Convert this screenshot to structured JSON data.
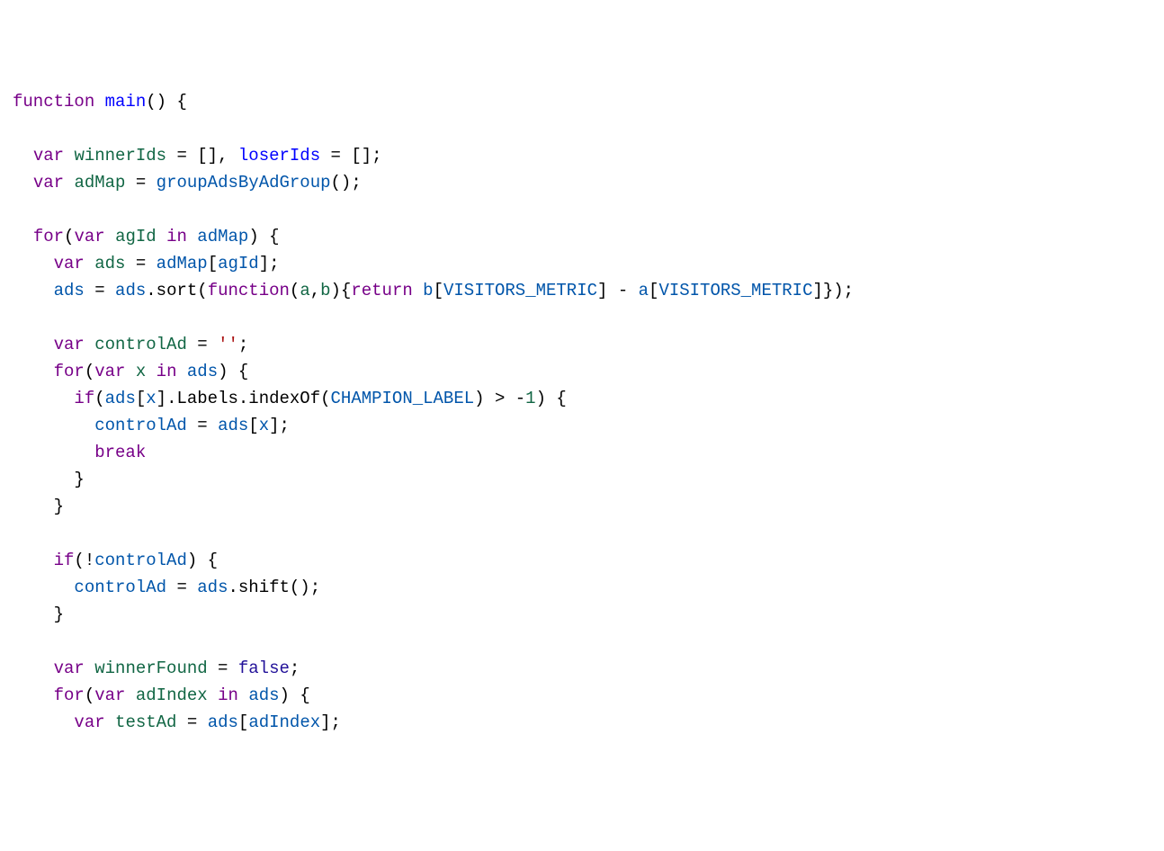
{
  "code": {
    "tokens": [
      [
        {
          "t": "function",
          "c": "kw"
        },
        {
          "t": " "
        },
        {
          "t": "main",
          "c": "fn"
        },
        {
          "t": "() {"
        }
      ],
      [
        {
          "t": ""
        }
      ],
      [
        {
          "t": "  "
        },
        {
          "t": "var",
          "c": "kw"
        },
        {
          "t": " "
        },
        {
          "t": "winnerIds",
          "c": "id"
        },
        {
          "t": " = [], "
        },
        {
          "t": "loserIds",
          "c": "fn"
        },
        {
          "t": " = [];"
        }
      ],
      [
        {
          "t": "  "
        },
        {
          "t": "var",
          "c": "kw"
        },
        {
          "t": " "
        },
        {
          "t": "adMap",
          "c": "id"
        },
        {
          "t": " = "
        },
        {
          "t": "groupAdsByAdGroup",
          "c": "use"
        },
        {
          "t": "();"
        }
      ],
      [
        {
          "t": ""
        }
      ],
      [
        {
          "t": "  "
        },
        {
          "t": "for",
          "c": "kw"
        },
        {
          "t": "("
        },
        {
          "t": "var",
          "c": "kw"
        },
        {
          "t": " "
        },
        {
          "t": "agId",
          "c": "id"
        },
        {
          "t": " "
        },
        {
          "t": "in",
          "c": "kw"
        },
        {
          "t": " "
        },
        {
          "t": "adMap",
          "c": "use"
        },
        {
          "t": ") {"
        }
      ],
      [
        {
          "t": "    "
        },
        {
          "t": "var",
          "c": "kw"
        },
        {
          "t": " "
        },
        {
          "t": "ads",
          "c": "id"
        },
        {
          "t": " = "
        },
        {
          "t": "adMap",
          "c": "use"
        },
        {
          "t": "["
        },
        {
          "t": "agId",
          "c": "use"
        },
        {
          "t": "];"
        }
      ],
      [
        {
          "t": "    "
        },
        {
          "t": "ads",
          "c": "use"
        },
        {
          "t": " = "
        },
        {
          "t": "ads",
          "c": "use"
        },
        {
          "t": ".sort("
        },
        {
          "t": "function",
          "c": "kw"
        },
        {
          "t": "("
        },
        {
          "t": "a",
          "c": "id"
        },
        {
          "t": ","
        },
        {
          "t": "b",
          "c": "id"
        },
        {
          "t": "){"
        },
        {
          "t": "return",
          "c": "kw"
        },
        {
          "t": " "
        },
        {
          "t": "b",
          "c": "use"
        },
        {
          "t": "["
        },
        {
          "t": "VISITORS_METRIC",
          "c": "use"
        },
        {
          "t": "] - "
        },
        {
          "t": "a",
          "c": "use"
        },
        {
          "t": "["
        },
        {
          "t": "VISITORS_METRIC",
          "c": "use"
        },
        {
          "t": "]});"
        }
      ],
      [
        {
          "t": ""
        }
      ],
      [
        {
          "t": "    "
        },
        {
          "t": "var",
          "c": "kw"
        },
        {
          "t": " "
        },
        {
          "t": "controlAd",
          "c": "id"
        },
        {
          "t": " = "
        },
        {
          "t": "''",
          "c": "str"
        },
        {
          "t": ";"
        }
      ],
      [
        {
          "t": "    "
        },
        {
          "t": "for",
          "c": "kw"
        },
        {
          "t": "("
        },
        {
          "t": "var",
          "c": "kw"
        },
        {
          "t": " "
        },
        {
          "t": "x",
          "c": "id"
        },
        {
          "t": " "
        },
        {
          "t": "in",
          "c": "kw"
        },
        {
          "t": " "
        },
        {
          "t": "ads",
          "c": "use"
        },
        {
          "t": ") {"
        }
      ],
      [
        {
          "t": "      "
        },
        {
          "t": "if",
          "c": "kw"
        },
        {
          "t": "("
        },
        {
          "t": "ads",
          "c": "use"
        },
        {
          "t": "["
        },
        {
          "t": "x",
          "c": "use"
        },
        {
          "t": "].Labels.indexOf("
        },
        {
          "t": "CHAMPION_LABEL",
          "c": "use"
        },
        {
          "t": ") > -"
        },
        {
          "t": "1",
          "c": "num"
        },
        {
          "t": ") {"
        }
      ],
      [
        {
          "t": "        "
        },
        {
          "t": "controlAd",
          "c": "use"
        },
        {
          "t": " = "
        },
        {
          "t": "ads",
          "c": "use"
        },
        {
          "t": "["
        },
        {
          "t": "x",
          "c": "use"
        },
        {
          "t": "];"
        }
      ],
      [
        {
          "t": "        "
        },
        {
          "t": "break",
          "c": "kw"
        }
      ],
      [
        {
          "t": "      }"
        }
      ],
      [
        {
          "t": "    }"
        }
      ],
      [
        {
          "t": ""
        }
      ],
      [
        {
          "t": "    "
        },
        {
          "t": "if",
          "c": "kw"
        },
        {
          "t": "(!"
        },
        {
          "t": "controlAd",
          "c": "use"
        },
        {
          "t": ") {"
        }
      ],
      [
        {
          "t": "      "
        },
        {
          "t": "controlAd",
          "c": "use"
        },
        {
          "t": " = "
        },
        {
          "t": "ads",
          "c": "use"
        },
        {
          "t": ".shift();"
        }
      ],
      [
        {
          "t": "    }"
        }
      ],
      [
        {
          "t": ""
        }
      ],
      [
        {
          "t": "    "
        },
        {
          "t": "var",
          "c": "kw"
        },
        {
          "t": " "
        },
        {
          "t": "winnerFound",
          "c": "id"
        },
        {
          "t": " = "
        },
        {
          "t": "false",
          "c": "bool"
        },
        {
          "t": ";"
        }
      ],
      [
        {
          "t": "    "
        },
        {
          "t": "for",
          "c": "kw"
        },
        {
          "t": "("
        },
        {
          "t": "var",
          "c": "kw"
        },
        {
          "t": " "
        },
        {
          "t": "adIndex",
          "c": "id"
        },
        {
          "t": " "
        },
        {
          "t": "in",
          "c": "kw"
        },
        {
          "t": " "
        },
        {
          "t": "ads",
          "c": "use"
        },
        {
          "t": ") {"
        }
      ],
      [
        {
          "t": "      "
        },
        {
          "t": "var",
          "c": "kw"
        },
        {
          "t": " "
        },
        {
          "t": "testAd",
          "c": "id"
        },
        {
          "t": " = "
        },
        {
          "t": "ads",
          "c": "use"
        },
        {
          "t": "["
        },
        {
          "t": "adIndex",
          "c": "use"
        },
        {
          "t": "];"
        }
      ]
    ]
  }
}
